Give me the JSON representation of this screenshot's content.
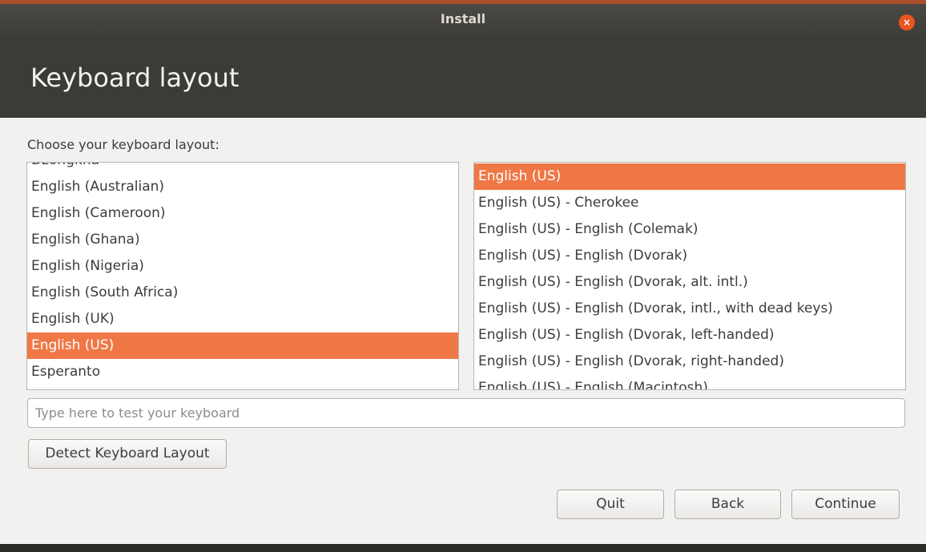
{
  "window": {
    "title": "Install",
    "close_icon": "×"
  },
  "header": {
    "title": "Keyboard layout"
  },
  "content": {
    "prompt": "Choose your keyboard layout:",
    "layouts": [
      {
        "label": "Dzongkha",
        "selected": false
      },
      {
        "label": "English (Australian)",
        "selected": false
      },
      {
        "label": "English (Cameroon)",
        "selected": false
      },
      {
        "label": "English (Ghana)",
        "selected": false
      },
      {
        "label": "English (Nigeria)",
        "selected": false
      },
      {
        "label": "English (South Africa)",
        "selected": false
      },
      {
        "label": "English (UK)",
        "selected": false
      },
      {
        "label": "English (US)",
        "selected": true
      },
      {
        "label": "Esperanto",
        "selected": false
      }
    ],
    "variants": [
      {
        "label": "English (US)",
        "selected": true
      },
      {
        "label": "English (US) - Cherokee",
        "selected": false
      },
      {
        "label": "English (US) - English (Colemak)",
        "selected": false
      },
      {
        "label": "English (US) - English (Dvorak)",
        "selected": false
      },
      {
        "label": "English (US) - English (Dvorak, alt. intl.)",
        "selected": false
      },
      {
        "label": "English (US) - English (Dvorak, intl., with dead keys)",
        "selected": false
      },
      {
        "label": "English (US) - English (Dvorak, left-handed)",
        "selected": false
      },
      {
        "label": "English (US) - English (Dvorak, right-handed)",
        "selected": false
      },
      {
        "label": "English (US) - English (Macintosh)",
        "selected": false
      }
    ],
    "test_input": {
      "placeholder": "Type here to test your keyboard",
      "value": ""
    },
    "detect_label": "Detect Keyboard Layout"
  },
  "footer": {
    "quit_label": "Quit",
    "back_label": "Back",
    "continue_label": "Continue"
  },
  "colors": {
    "accent": "#f07746",
    "close": "#e95420",
    "header_bg": "#3c3b37",
    "body_bg": "#f2f1f0"
  }
}
